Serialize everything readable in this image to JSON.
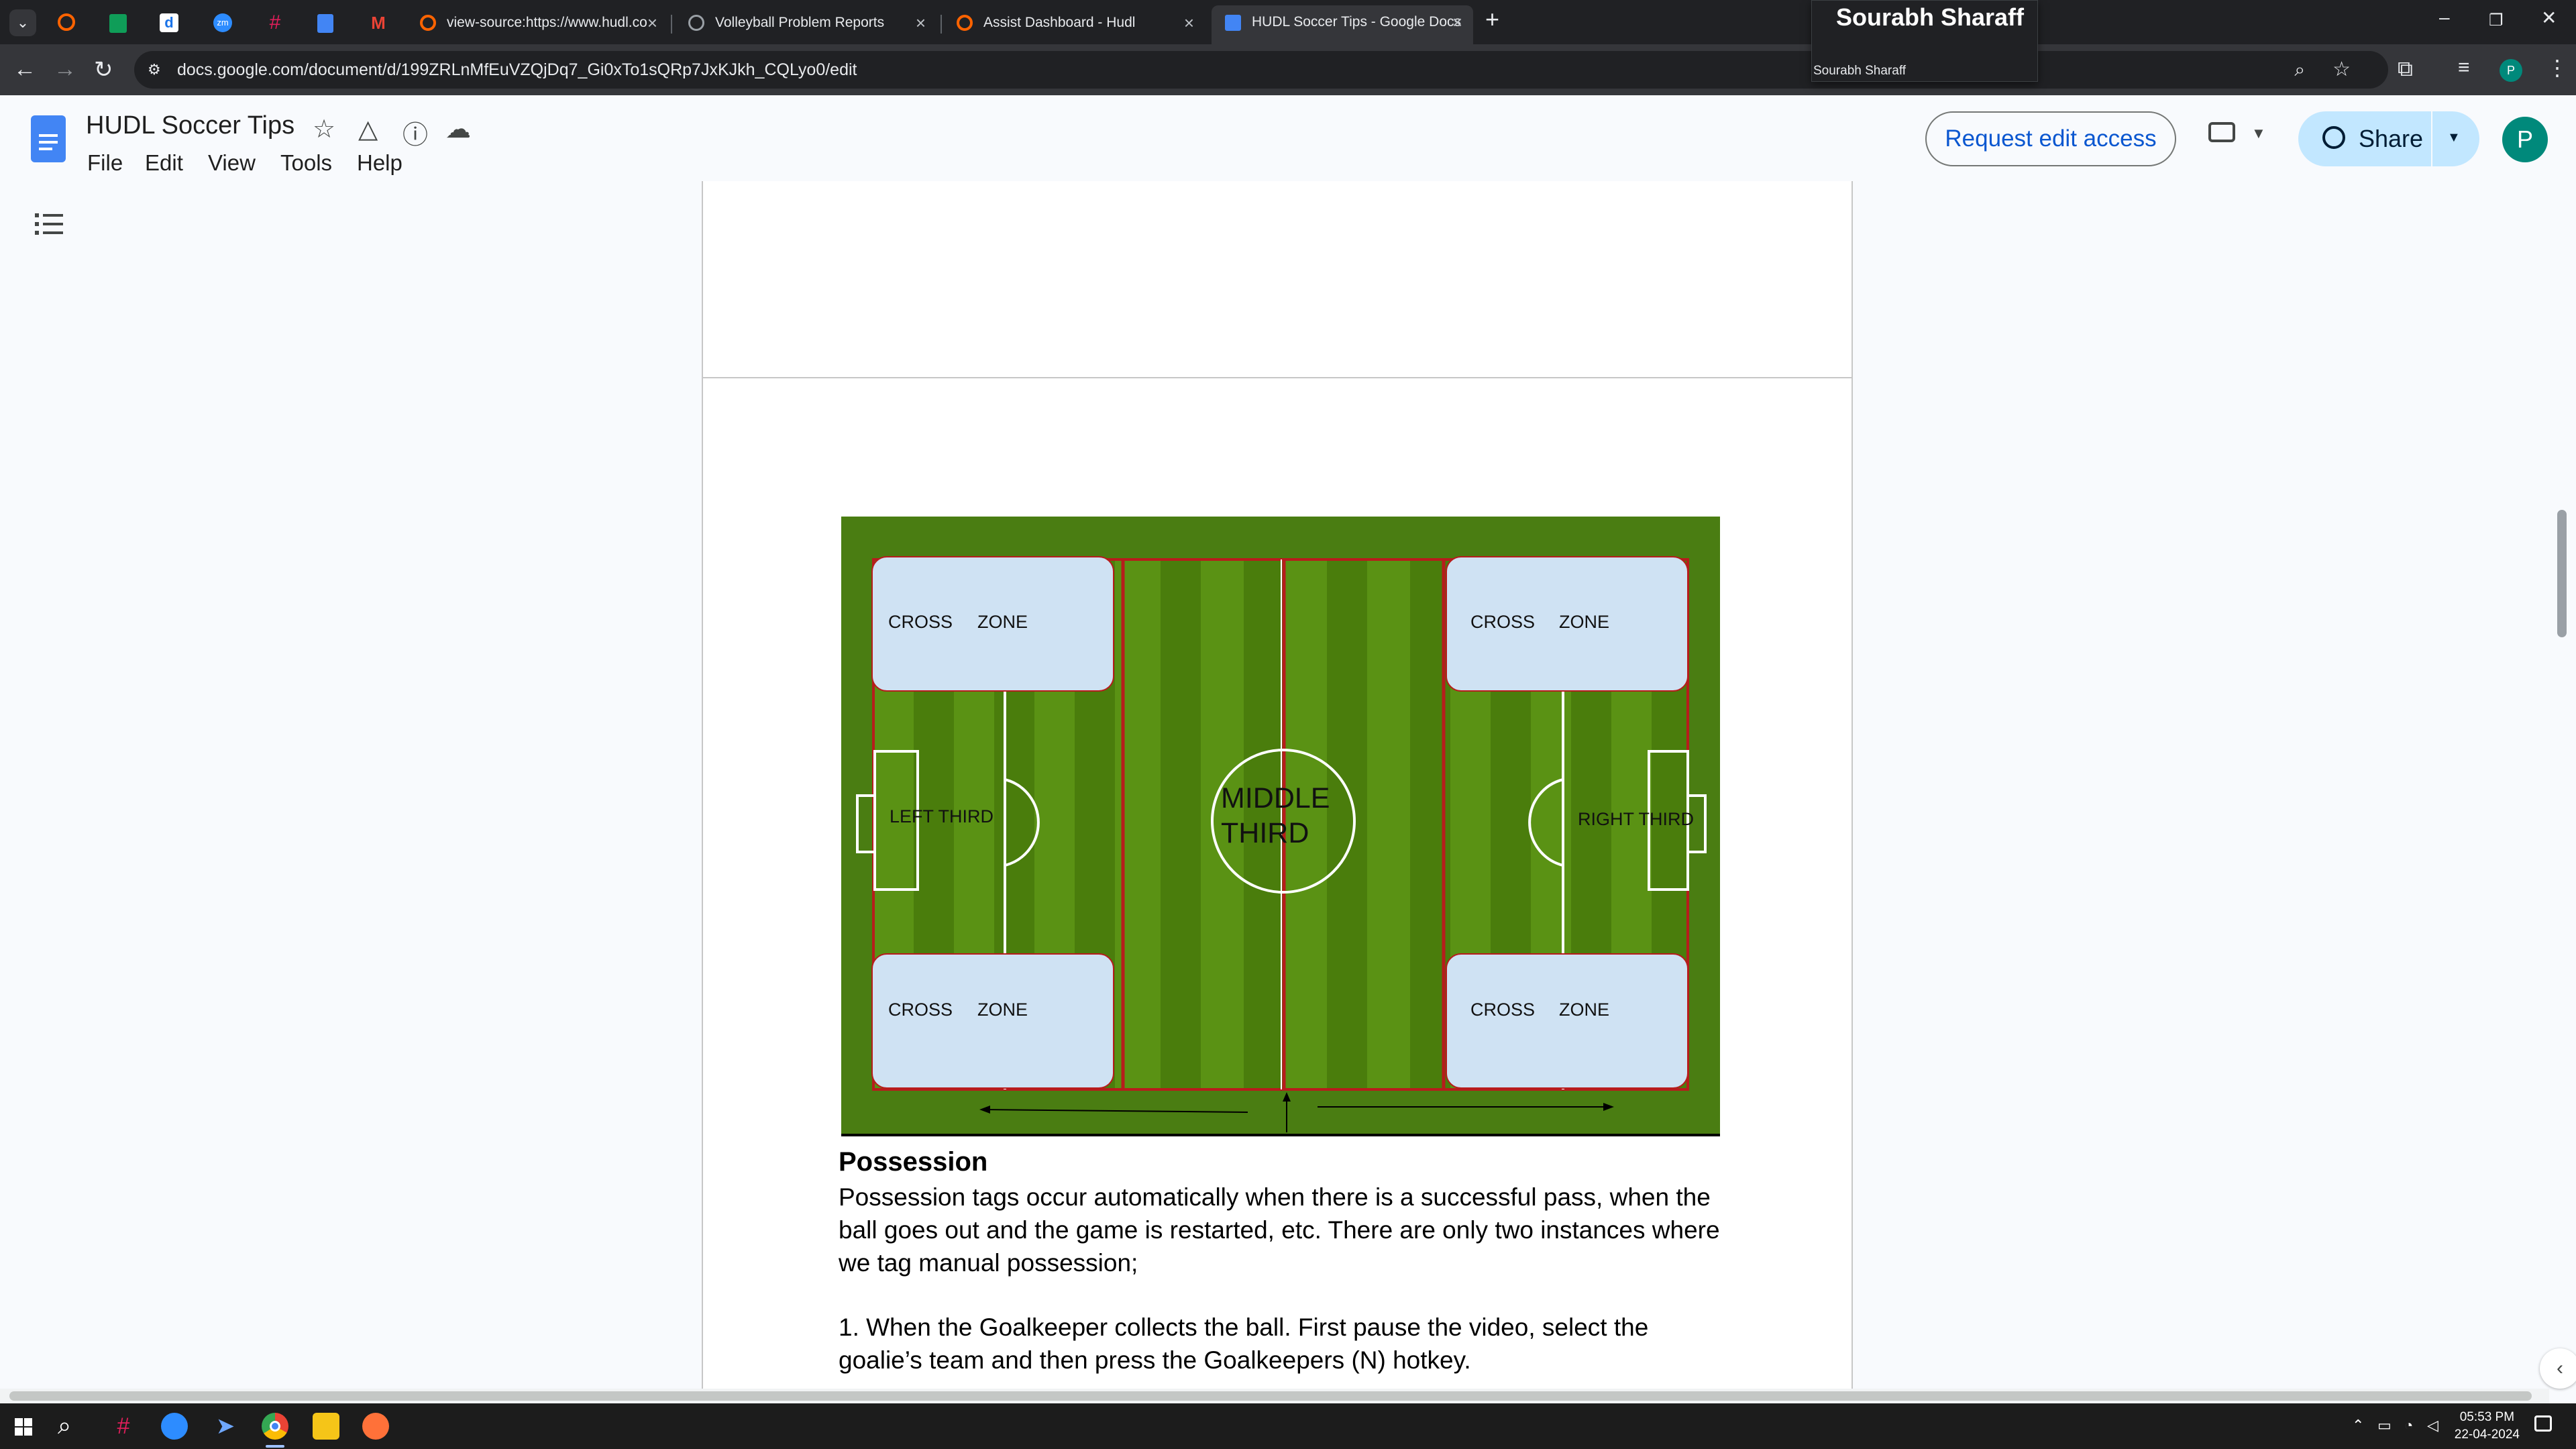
{
  "browser": {
    "tabs": [
      {
        "title": "view-source:https://www.hudl.co",
        "icon": "hudl-icon",
        "color": "#ff6300"
      },
      {
        "title": "Volleyball Problem Reports",
        "icon": "globe-icon",
        "color": "#9aa0a6"
      },
      {
        "title": "Assist Dashboard - Hudl",
        "icon": "hudl-icon",
        "color": "#ff6300"
      },
      {
        "title": "HUDL Soccer Tips - Google Docs",
        "icon": "docs-icon",
        "color": "#4285f4"
      }
    ],
    "url": "docs.google.com/document/d/199ZRLnMfEuVZQjDq7_Gi0xTo1sQRp7JxKJkh_CQLyo0/edit",
    "profile_tooltip": {
      "name": "Sourabh Sharaff",
      "sub": "Sourabh Sharaff"
    },
    "profile_initial": "P"
  },
  "docs": {
    "title": "HUDL Soccer Tips",
    "menu": [
      "File",
      "Edit",
      "View",
      "Tools",
      "Help"
    ],
    "request_edit": "Request edit access",
    "share": "Share",
    "avatar_initial": "P",
    "accent": "#0b57d0"
  },
  "field": {
    "cross_zone_words": [
      "CROSS",
      "ZONE"
    ],
    "left_third": "LEFT THIRD",
    "middle_third": [
      "MIDDLE",
      "THIRD"
    ],
    "right_third": "RIGHT THIRD"
  },
  "content": {
    "heading": "Possession",
    "para1_lines": [
      "Possession tags occur automatically when there is a successful pass, when the",
      "ball goes out and the game is restarted, etc. There are only two instances where",
      "we tag manual possession;"
    ],
    "para2_lines": [
      "1. When the Goalkeeper collects the ball. First pause the video, select the",
      "goalie’s team and then press the Goalkeepers (N) hotkey."
    ]
  },
  "taskbar": {
    "time": "05:53 PM",
    "date": "22-04-2024"
  }
}
